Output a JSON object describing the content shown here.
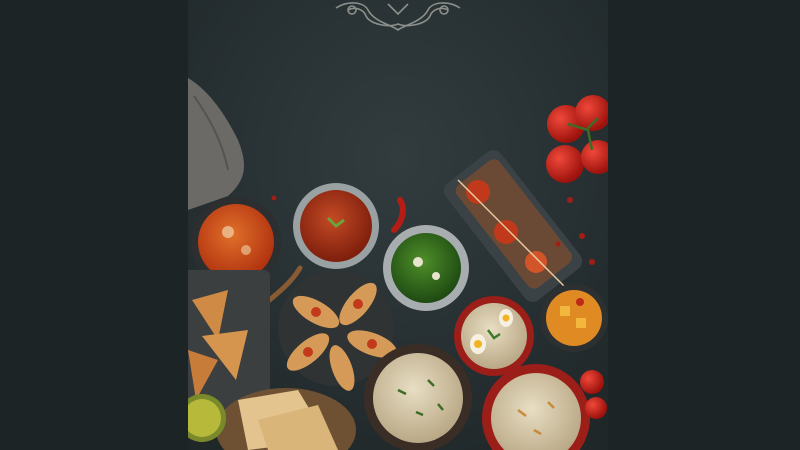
{
  "image": {
    "description_icon": "photo",
    "colors": {
      "backdrop": "#1c2426",
      "tabletop": "#2a3336",
      "ornament": "#8d8f8a",
      "curry_red": "#c7401c",
      "curry_orange": "#d9651e",
      "palak_green": "#2f6d1d",
      "rice": "#d8cfb4",
      "bread": "#d69a58",
      "tomato": "#c81e16",
      "cloth": "#6b6a66"
    }
  }
}
